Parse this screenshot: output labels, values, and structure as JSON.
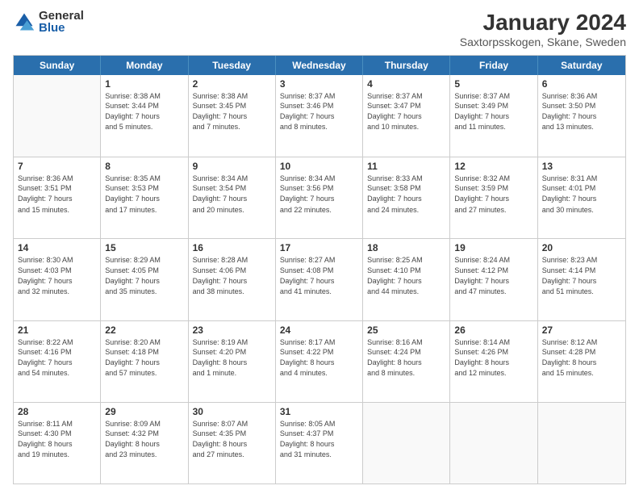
{
  "header": {
    "logo_general": "General",
    "logo_blue": "Blue",
    "month_title": "January 2024",
    "location": "Saxtorpsskogen, Skane, Sweden"
  },
  "days_of_week": [
    "Sunday",
    "Monday",
    "Tuesday",
    "Wednesday",
    "Thursday",
    "Friday",
    "Saturday"
  ],
  "weeks": [
    [
      {
        "day": "",
        "lines": []
      },
      {
        "day": "1",
        "lines": [
          "Sunrise: 8:38 AM",
          "Sunset: 3:44 PM",
          "Daylight: 7 hours",
          "and 5 minutes."
        ]
      },
      {
        "day": "2",
        "lines": [
          "Sunrise: 8:38 AM",
          "Sunset: 3:45 PM",
          "Daylight: 7 hours",
          "and 7 minutes."
        ]
      },
      {
        "day": "3",
        "lines": [
          "Sunrise: 8:37 AM",
          "Sunset: 3:46 PM",
          "Daylight: 7 hours",
          "and 8 minutes."
        ]
      },
      {
        "day": "4",
        "lines": [
          "Sunrise: 8:37 AM",
          "Sunset: 3:47 PM",
          "Daylight: 7 hours",
          "and 10 minutes."
        ]
      },
      {
        "day": "5",
        "lines": [
          "Sunrise: 8:37 AM",
          "Sunset: 3:49 PM",
          "Daylight: 7 hours",
          "and 11 minutes."
        ]
      },
      {
        "day": "6",
        "lines": [
          "Sunrise: 8:36 AM",
          "Sunset: 3:50 PM",
          "Daylight: 7 hours",
          "and 13 minutes."
        ]
      }
    ],
    [
      {
        "day": "7",
        "lines": [
          "Sunrise: 8:36 AM",
          "Sunset: 3:51 PM",
          "Daylight: 7 hours",
          "and 15 minutes."
        ]
      },
      {
        "day": "8",
        "lines": [
          "Sunrise: 8:35 AM",
          "Sunset: 3:53 PM",
          "Daylight: 7 hours",
          "and 17 minutes."
        ]
      },
      {
        "day": "9",
        "lines": [
          "Sunrise: 8:34 AM",
          "Sunset: 3:54 PM",
          "Daylight: 7 hours",
          "and 20 minutes."
        ]
      },
      {
        "day": "10",
        "lines": [
          "Sunrise: 8:34 AM",
          "Sunset: 3:56 PM",
          "Daylight: 7 hours",
          "and 22 minutes."
        ]
      },
      {
        "day": "11",
        "lines": [
          "Sunrise: 8:33 AM",
          "Sunset: 3:58 PM",
          "Daylight: 7 hours",
          "and 24 minutes."
        ]
      },
      {
        "day": "12",
        "lines": [
          "Sunrise: 8:32 AM",
          "Sunset: 3:59 PM",
          "Daylight: 7 hours",
          "and 27 minutes."
        ]
      },
      {
        "day": "13",
        "lines": [
          "Sunrise: 8:31 AM",
          "Sunset: 4:01 PM",
          "Daylight: 7 hours",
          "and 30 minutes."
        ]
      }
    ],
    [
      {
        "day": "14",
        "lines": [
          "Sunrise: 8:30 AM",
          "Sunset: 4:03 PM",
          "Daylight: 7 hours",
          "and 32 minutes."
        ]
      },
      {
        "day": "15",
        "lines": [
          "Sunrise: 8:29 AM",
          "Sunset: 4:05 PM",
          "Daylight: 7 hours",
          "and 35 minutes."
        ]
      },
      {
        "day": "16",
        "lines": [
          "Sunrise: 8:28 AM",
          "Sunset: 4:06 PM",
          "Daylight: 7 hours",
          "and 38 minutes."
        ]
      },
      {
        "day": "17",
        "lines": [
          "Sunrise: 8:27 AM",
          "Sunset: 4:08 PM",
          "Daylight: 7 hours",
          "and 41 minutes."
        ]
      },
      {
        "day": "18",
        "lines": [
          "Sunrise: 8:25 AM",
          "Sunset: 4:10 PM",
          "Daylight: 7 hours",
          "and 44 minutes."
        ]
      },
      {
        "day": "19",
        "lines": [
          "Sunrise: 8:24 AM",
          "Sunset: 4:12 PM",
          "Daylight: 7 hours",
          "and 47 minutes."
        ]
      },
      {
        "day": "20",
        "lines": [
          "Sunrise: 8:23 AM",
          "Sunset: 4:14 PM",
          "Daylight: 7 hours",
          "and 51 minutes."
        ]
      }
    ],
    [
      {
        "day": "21",
        "lines": [
          "Sunrise: 8:22 AM",
          "Sunset: 4:16 PM",
          "Daylight: 7 hours",
          "and 54 minutes."
        ]
      },
      {
        "day": "22",
        "lines": [
          "Sunrise: 8:20 AM",
          "Sunset: 4:18 PM",
          "Daylight: 7 hours",
          "and 57 minutes."
        ]
      },
      {
        "day": "23",
        "lines": [
          "Sunrise: 8:19 AM",
          "Sunset: 4:20 PM",
          "Daylight: 8 hours",
          "and 1 minute."
        ]
      },
      {
        "day": "24",
        "lines": [
          "Sunrise: 8:17 AM",
          "Sunset: 4:22 PM",
          "Daylight: 8 hours",
          "and 4 minutes."
        ]
      },
      {
        "day": "25",
        "lines": [
          "Sunrise: 8:16 AM",
          "Sunset: 4:24 PM",
          "Daylight: 8 hours",
          "and 8 minutes."
        ]
      },
      {
        "day": "26",
        "lines": [
          "Sunrise: 8:14 AM",
          "Sunset: 4:26 PM",
          "Daylight: 8 hours",
          "and 12 minutes."
        ]
      },
      {
        "day": "27",
        "lines": [
          "Sunrise: 8:12 AM",
          "Sunset: 4:28 PM",
          "Daylight: 8 hours",
          "and 15 minutes."
        ]
      }
    ],
    [
      {
        "day": "28",
        "lines": [
          "Sunrise: 8:11 AM",
          "Sunset: 4:30 PM",
          "Daylight: 8 hours",
          "and 19 minutes."
        ]
      },
      {
        "day": "29",
        "lines": [
          "Sunrise: 8:09 AM",
          "Sunset: 4:32 PM",
          "Daylight: 8 hours",
          "and 23 minutes."
        ]
      },
      {
        "day": "30",
        "lines": [
          "Sunrise: 8:07 AM",
          "Sunset: 4:35 PM",
          "Daylight: 8 hours",
          "and 27 minutes."
        ]
      },
      {
        "day": "31",
        "lines": [
          "Sunrise: 8:05 AM",
          "Sunset: 4:37 PM",
          "Daylight: 8 hours",
          "and 31 minutes."
        ]
      },
      {
        "day": "",
        "lines": []
      },
      {
        "day": "",
        "lines": []
      },
      {
        "day": "",
        "lines": []
      }
    ]
  ]
}
